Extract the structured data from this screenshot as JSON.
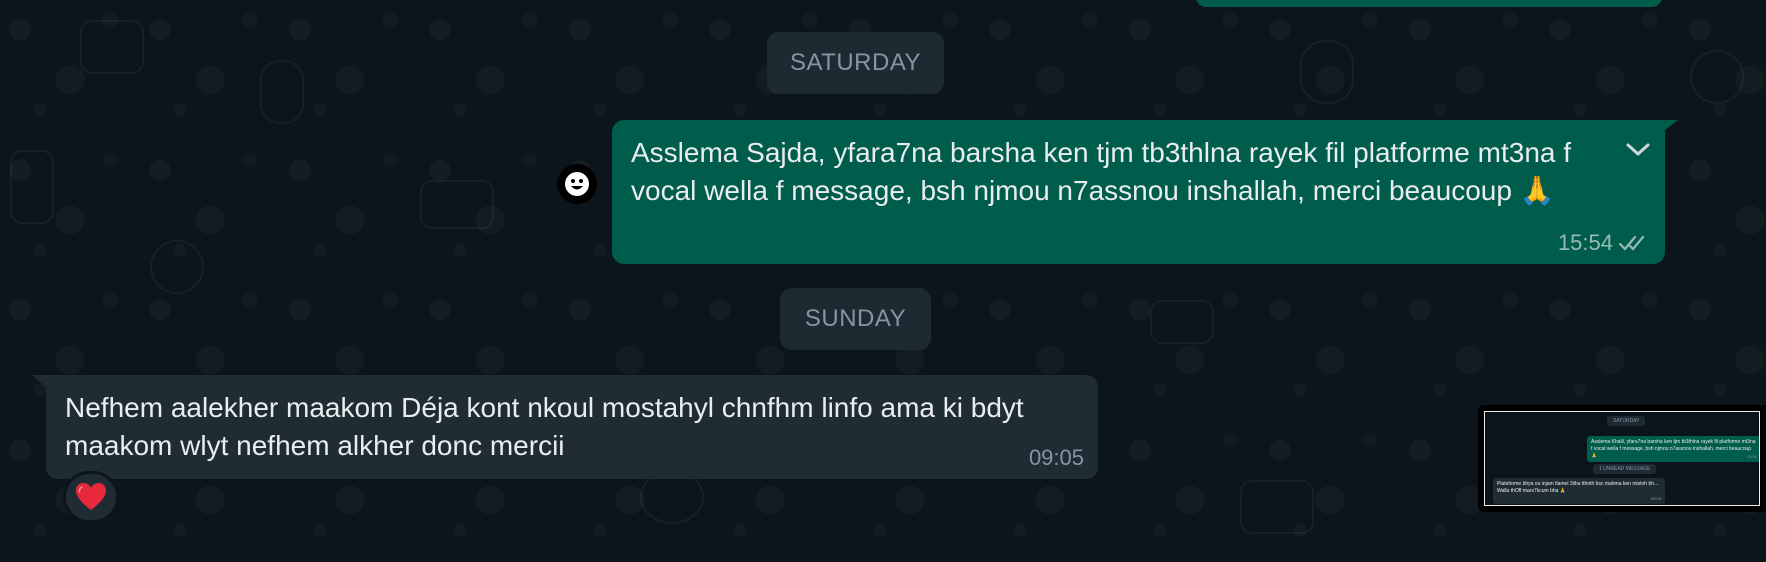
{
  "chat": {
    "date_separators": [
      "SATURDAY",
      "SUNDAY"
    ],
    "outgoing_message": {
      "text": "Asslema Sajda, yfara7na barsha ken tjm tb3thlna rayek fil platforme mt3na f\nvocal wella f message, bsh njmou n7assnou inshallah, merci beaucoup 🙏",
      "time": "15:54",
      "status_icon": "double-check-icon",
      "menu_icon": "chevron-down-icon"
    },
    "incoming_message": {
      "text": "Nefhem aalekher maakom Déja kont nkoul mostahyl chnfhm linfo ama ki bdyt\nmaakom wlyt nefhem alkher donc mercii",
      "time": "09:05",
      "reaction": "❤️"
    },
    "avatar_icon": "smiley-face-icon"
  },
  "thumbnail": {
    "chip_saturday": "SATURDAY",
    "outgoing_text": "Asslema Khalil, yfara7na barsha ken tjm tb3thlna rayek fil platforme mt3na f vocal wella f message, bsh njmou n7assnou inshallah, merci beaucoup 🙏",
    "outgoing_time": "15:54",
    "unread_chip": "1 UNREAD MESSAGE",
    "incoming_text": "Plateforme bhya ou injam tlamel 3liha tthnth bsc mahma ken mistoh bh... Walla thOff mars7kcum bha 🙏",
    "incoming_time": "09:05"
  },
  "colors": {
    "background": "#0c151b",
    "outgoing_bubble": "#005c4b",
    "incoming_bubble": "#202c33",
    "date_chip": "#1d2a32",
    "meta_text": "#8696a0"
  }
}
